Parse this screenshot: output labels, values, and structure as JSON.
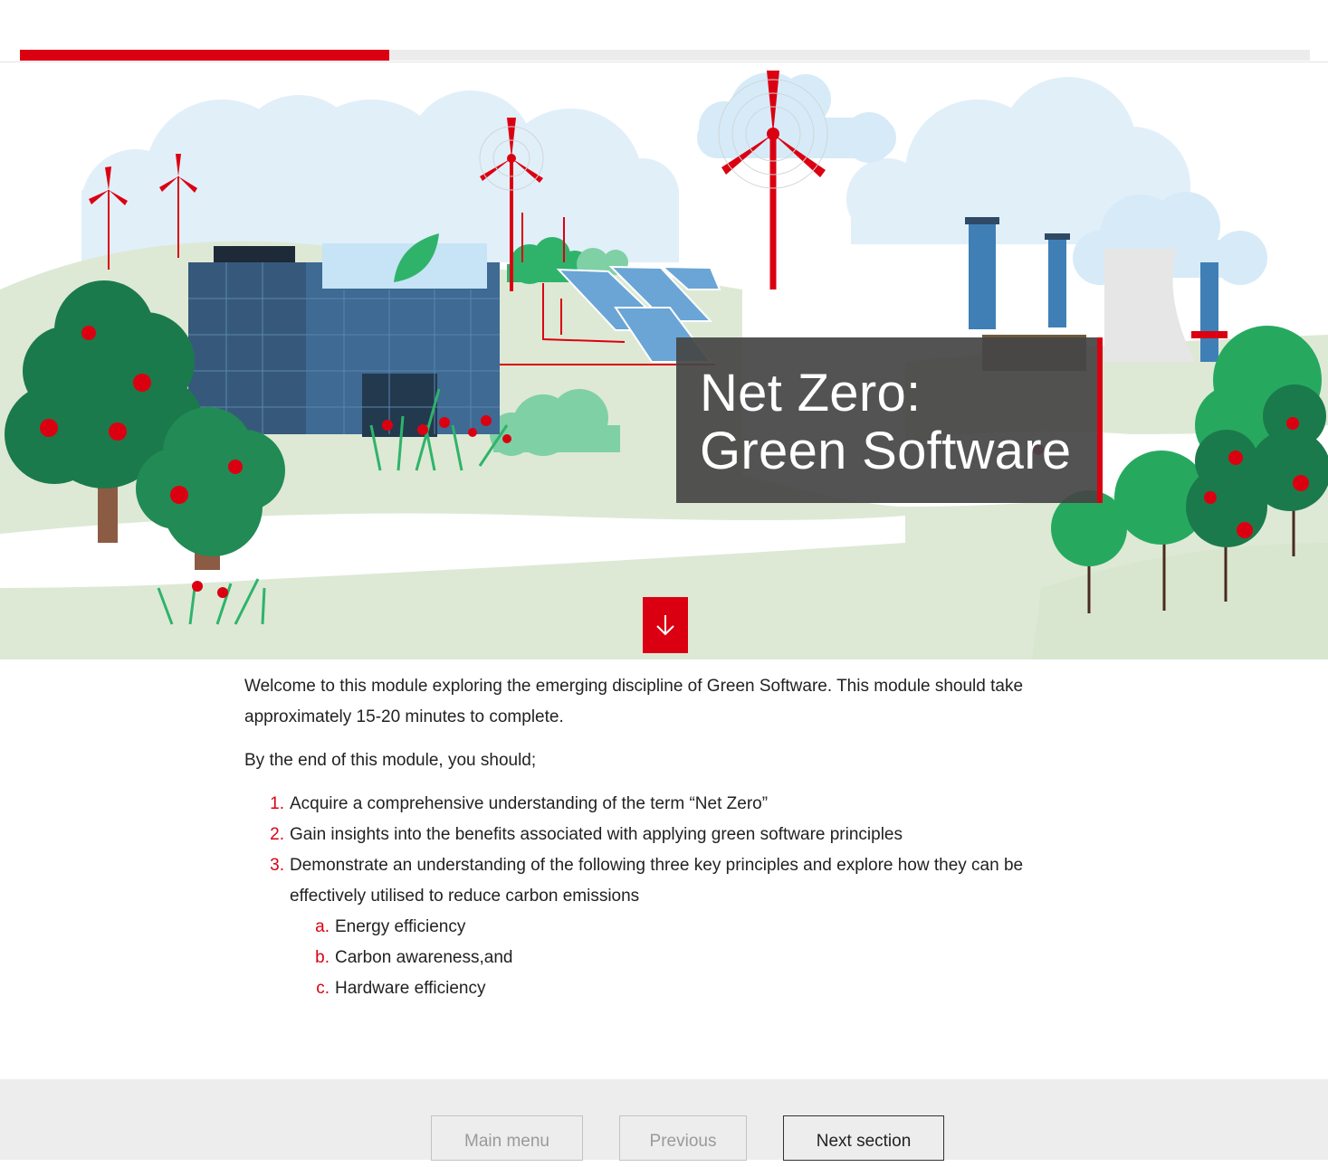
{
  "progress": {
    "fraction": 0.286
  },
  "hero": {
    "title_line1": "Net Zero:",
    "title_line2": "Green Software",
    "scroll_icon": "arrow-down-icon"
  },
  "intro": {
    "paragraph1": "Welcome to this module exploring the emerging discipline of Green Software. This module should take approximately 15-20 minutes to complete.",
    "paragraph2": "By the end of this module, you should;"
  },
  "objectives": [
    {
      "marker": "1.",
      "text": "Acquire a comprehensive understanding of the term “Net Zero”"
    },
    {
      "marker": "2.",
      "text": "Gain insights into the benefits associated with applying green software principles"
    },
    {
      "marker": "3.",
      "text": "Demonstrate an understanding of the following three key principles and explore how they can be effectively utilised to reduce carbon emissions"
    }
  ],
  "sub_objectives": [
    {
      "marker": "a.",
      "text": "Energy efficiency"
    },
    {
      "marker": "b.",
      "text": "Carbon awareness,and"
    },
    {
      "marker": "c.",
      "text": "Hardware efficiency"
    }
  ],
  "footer": {
    "main_menu": "Main menu",
    "previous": "Previous",
    "next_section": "Next section"
  },
  "colors": {
    "accent": "#db0011",
    "footer_bg": "#ededed"
  }
}
